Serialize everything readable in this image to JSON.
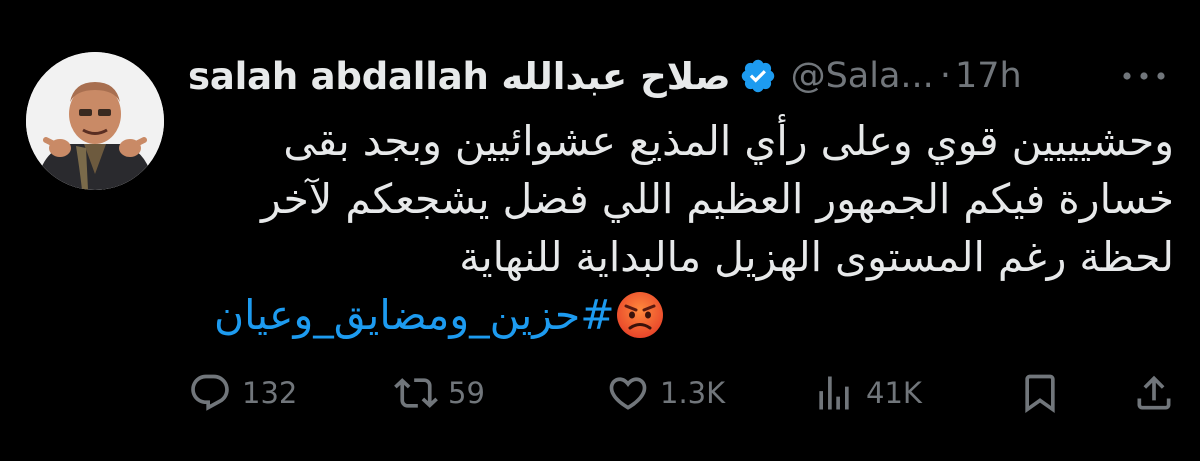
{
  "tweet": {
    "author": {
      "display_name": "salah abdallah صلاح عبدالله",
      "verified": true,
      "handle": "@Sala...",
      "avatar_icon": "profile-photo"
    },
    "separator": "·",
    "timestamp": "17h",
    "text_lines": [
      "وحشيييين قوي وعلى رأي المذيع عشوائيين وبجد بقى",
      "خسارة فيكم الجمهور العظيم اللي فضل يشجعكم لآخر",
      "لحظة رغم المستوى الهزيل مالبداية للنهاية"
    ],
    "hashtag": "#حزين_ومضايق_وعيان",
    "emoji": "angry-face",
    "actions": {
      "replies": "132",
      "retweets": "59",
      "likes": "1.3K",
      "views": "41K"
    }
  },
  "colors": {
    "background": "#000000",
    "text": "#e7e9ea",
    "secondary": "#71767b",
    "accent": "#1d9bf0",
    "verified": "#1d9bf0",
    "emoji": "#ef6a2e"
  }
}
